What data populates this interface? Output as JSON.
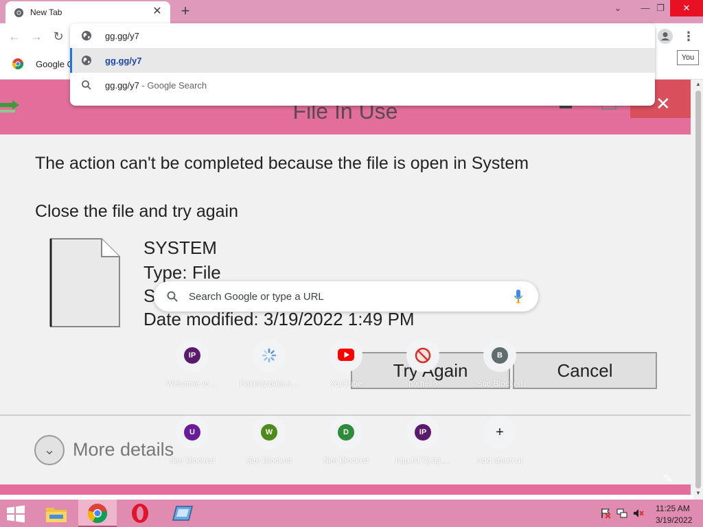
{
  "browser": {
    "tab": {
      "title": "New Tab"
    },
    "tooltip": "You"
  },
  "omnibox": {
    "input_value": "gg.gg/y7",
    "selected_suggestion": "gg.gg/y7",
    "search_suggestion_query": "gg.gg/y7",
    "search_suggestion_suffix": " - Google Search"
  },
  "bookmarks": {
    "items": [
      {
        "label": "Google C",
        "icon": "chrome-icon"
      }
    ]
  },
  "fake_dialog": {
    "title": "File In Use",
    "message": "The action can't be completed because the file is open in System",
    "instruction": "Close the file and try again",
    "file": {
      "name": "SYSTEM",
      "type_line": "Type: File",
      "size_line_partial": "S",
      "date_line": "Date modified: 3/19/2022 1:49 PM"
    },
    "try_again_label": "Try Again",
    "cancel_label": "Cancel",
    "more_details_label": "More details"
  },
  "ntp": {
    "search_placeholder": "Search Google or type a URL",
    "shortcuts": [
      {
        "label": "Welcome to ...",
        "badge": "IP",
        "color": "#5b1a6e"
      },
      {
        "label": "FakeUpdate.n...",
        "badge": "",
        "color": "#4a90d9"
      },
      {
        "label": "YouTube",
        "badge": "",
        "color": "#ff0000"
      },
      {
        "label": "no hello",
        "badge": "",
        "color": "#d93025"
      },
      {
        "label": "Site Blocked",
        "badge": "B",
        "color": "#5f6d6e"
      },
      {
        "label": "Site Blocked",
        "badge": "U",
        "color": "#6a1b9a"
      },
      {
        "label": "Site Blocked",
        "badge": "W",
        "color": "#4e8a1a"
      },
      {
        "label": "Site Blocked",
        "badge": "D",
        "color": "#2e8b3a"
      },
      {
        "label": "http://172.81....",
        "badge": "IP",
        "color": "#5b1a6e"
      },
      {
        "label": "Add shortcut",
        "badge": "+",
        "color": ""
      }
    ]
  },
  "taskbar": {
    "time": "11:25 AM",
    "date": "3/19/2022"
  },
  "colors": {
    "pink_frame": "#de9aba",
    "dialog_header": "#e36e9b",
    "close_red": "#e81123",
    "accent_blue": "#1a73e8"
  }
}
